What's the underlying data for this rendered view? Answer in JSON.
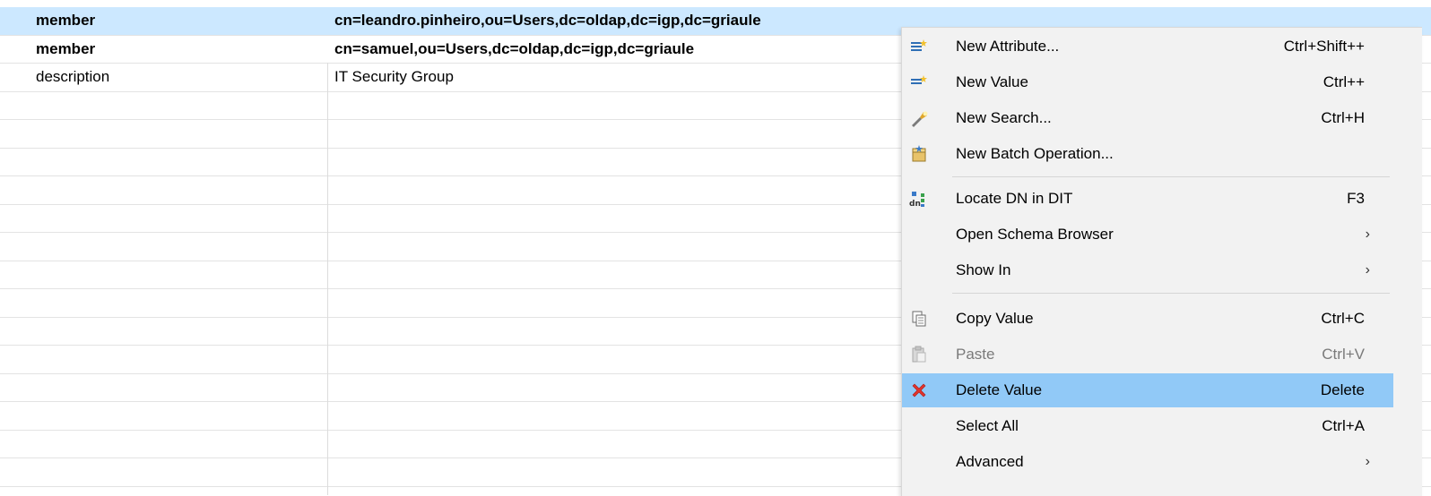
{
  "table": {
    "rows": [
      {
        "attribute": "member",
        "value": "cn=leandro.pinheiro,ou=Users,dc=oldap,dc=igp,dc=griaule"
      },
      {
        "attribute": "member",
        "value": "cn=samuel,ou=Users,dc=oldap,dc=igp,dc=griaule"
      },
      {
        "attribute": "description",
        "value": "IT Security Group"
      }
    ]
  },
  "context_menu": {
    "items": [
      {
        "label": "New Attribute...",
        "shortcut": "Ctrl+Shift++",
        "icon": "new-attribute-icon"
      },
      {
        "label": "New Value",
        "shortcut": "Ctrl++",
        "icon": "new-value-icon"
      },
      {
        "label": "New Search...",
        "shortcut": "Ctrl+H",
        "icon": "search-flashlight-icon"
      },
      {
        "label": "New Batch Operation...",
        "shortcut": "",
        "icon": "batch-operation-icon"
      },
      {
        "label": "Locate DN in DIT",
        "shortcut": "F3",
        "icon": "locate-dn-icon"
      },
      {
        "label": "Open Schema Browser",
        "shortcut": "",
        "icon": "submenu-arrow-icon"
      },
      {
        "label": "Show In",
        "shortcut": "",
        "icon": "submenu-arrow-icon"
      },
      {
        "label": "Copy Value",
        "shortcut": "Ctrl+C",
        "icon": "copy-icon"
      },
      {
        "label": "Paste",
        "shortcut": "Ctrl+V",
        "icon": "paste-icon"
      },
      {
        "label": "Delete Value",
        "shortcut": "Delete",
        "icon": "delete-x-icon"
      },
      {
        "label": "Select All",
        "shortcut": "Ctrl+A",
        "icon": ""
      },
      {
        "label": "Advanced",
        "shortcut": "",
        "icon": "submenu-arrow-icon"
      }
    ],
    "submenu_arrow": "›",
    "highlight_color": "#91c9f7",
    "selected_row_color": "#cce8ff"
  }
}
